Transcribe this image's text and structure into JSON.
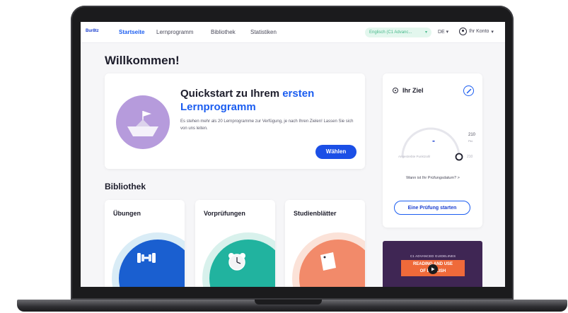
{
  "nav": {
    "logo": "Bur8tz",
    "links": [
      "Startseite",
      "Lernprogramm",
      "Bibliothek",
      "Statistiken"
    ],
    "language_pill": "Englisch (C1 Advanc...",
    "locale": "DE",
    "account_label": "Ihr Konto"
  },
  "welcome_title": "Willkommen!",
  "quickstart": {
    "title_prefix": "Quickstart zu Ihrem ",
    "title_highlight": "ersten",
    "title_suffix": "Lernprogramm",
    "description": "Es stehen mehr als 20 Lernprogramme zur Verfügung, je nach Ihren Zielen! Lassen Sie sich von uns leiten.",
    "button_label": "Wählen"
  },
  "goal": {
    "title": "Ihr Ziel",
    "score_value": "-",
    "max_score": "210",
    "max_score_sub": "Pkt.",
    "caption": "Angestrebte Punktzahl",
    "max_score_right": "210",
    "exam_date": "Wann ist Ihr Prüfungsdatum? >",
    "button_label": "Eine Prüfung starten"
  },
  "library": {
    "title": "Bibliothek",
    "cards": [
      {
        "title": "Übungen",
        "ring": "#d9ecf6",
        "disc": "#1a5fd0",
        "icon": "dumbbell-icon"
      },
      {
        "title": "Vorprüfungen",
        "ring": "#d8f1ec",
        "disc": "#21b39f",
        "icon": "alarm-clock-icon"
      },
      {
        "title": "Studienblätter",
        "ring": "#fbe2d8",
        "disc": "#f28a6a",
        "icon": "note-sheet-icon"
      }
    ]
  },
  "promo": {
    "top_line": "C1 ADVANCED GUIDELINES",
    "line1": "READING AND USE",
    "line2": "OF ENGLISH"
  },
  "colors": {
    "accent": "#1b5df0",
    "primary_button": "#1b4fe6",
    "quickstart_circle": "#b69bdc",
    "promo_bg": "#3f2654",
    "promo_band": "#ef6a3a"
  }
}
